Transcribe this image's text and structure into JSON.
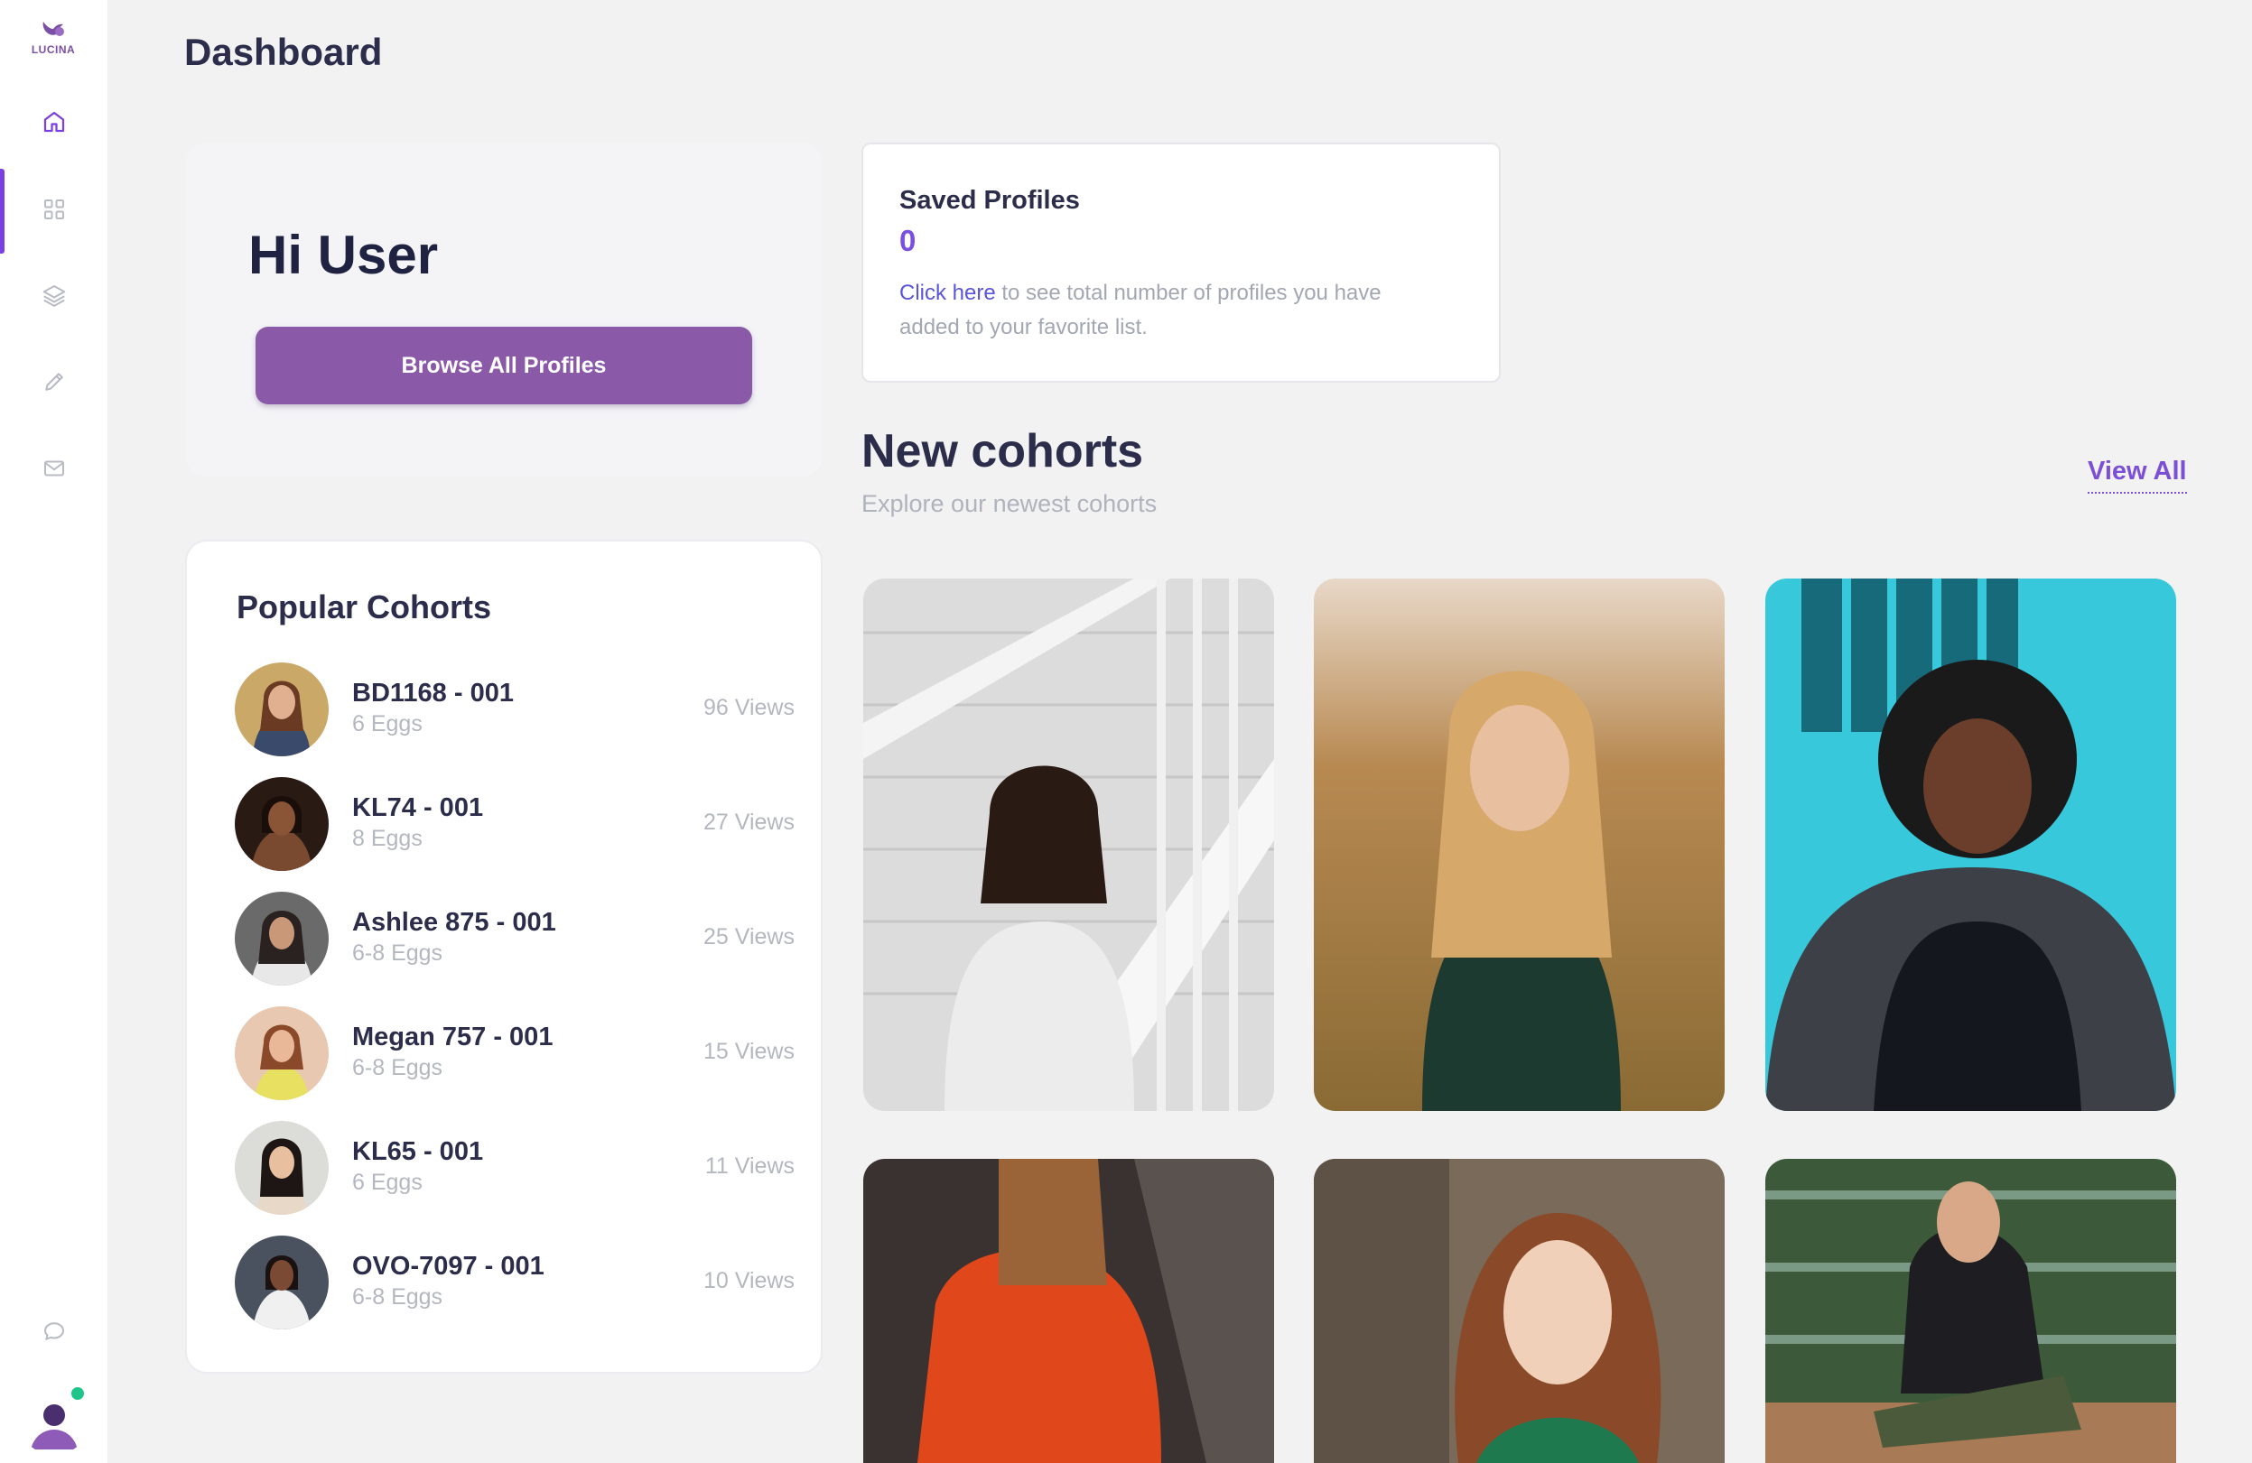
{
  "app": {
    "logo_text": "LUCINA"
  },
  "sidebar": {
    "items": [
      {
        "name": "home",
        "icon": "home-icon"
      },
      {
        "name": "grid",
        "icon": "grid-icon"
      },
      {
        "name": "layers",
        "icon": "layers-icon"
      },
      {
        "name": "edit",
        "icon": "pencil-icon"
      },
      {
        "name": "mail",
        "icon": "mail-icon"
      }
    ],
    "chat_icon": "chat-icon",
    "accent": "#7b3fe4",
    "status_color": "#1fc58a"
  },
  "header": {
    "title": "Dashboard"
  },
  "greeting": {
    "title": "Hi User",
    "browse_label": "Browse All Profiles",
    "button_color": "#8a5aa8"
  },
  "saved_profiles": {
    "title": "Saved Profiles",
    "count": "0",
    "link_text": "Click here",
    "description": " to see total number of profiles you have added to your favorite list."
  },
  "new_cohorts": {
    "title": "New cohorts",
    "subtitle": "Explore our newest cohorts",
    "view_all": "View All"
  },
  "popular": {
    "title": "Popular Cohorts",
    "items": [
      {
        "name": "BD1168 - 001",
        "eggs": "6 Eggs",
        "views": "96 Views"
      },
      {
        "name": "KL74 - 001",
        "eggs": "8 Eggs",
        "views": "27 Views"
      },
      {
        "name": "Ashlee 875 - 001",
        "eggs": "6-8 Eggs",
        "views": "25 Views"
      },
      {
        "name": "Megan 757 - 001",
        "eggs": "6-8 Eggs",
        "views": "15 Views"
      },
      {
        "name": "KL65 - 001",
        "eggs": "6 Eggs",
        "views": "11 Views"
      },
      {
        "name": "OVO-7097 - 001",
        "eggs": "6-8 Eggs",
        "views": "10 Views"
      }
    ]
  }
}
